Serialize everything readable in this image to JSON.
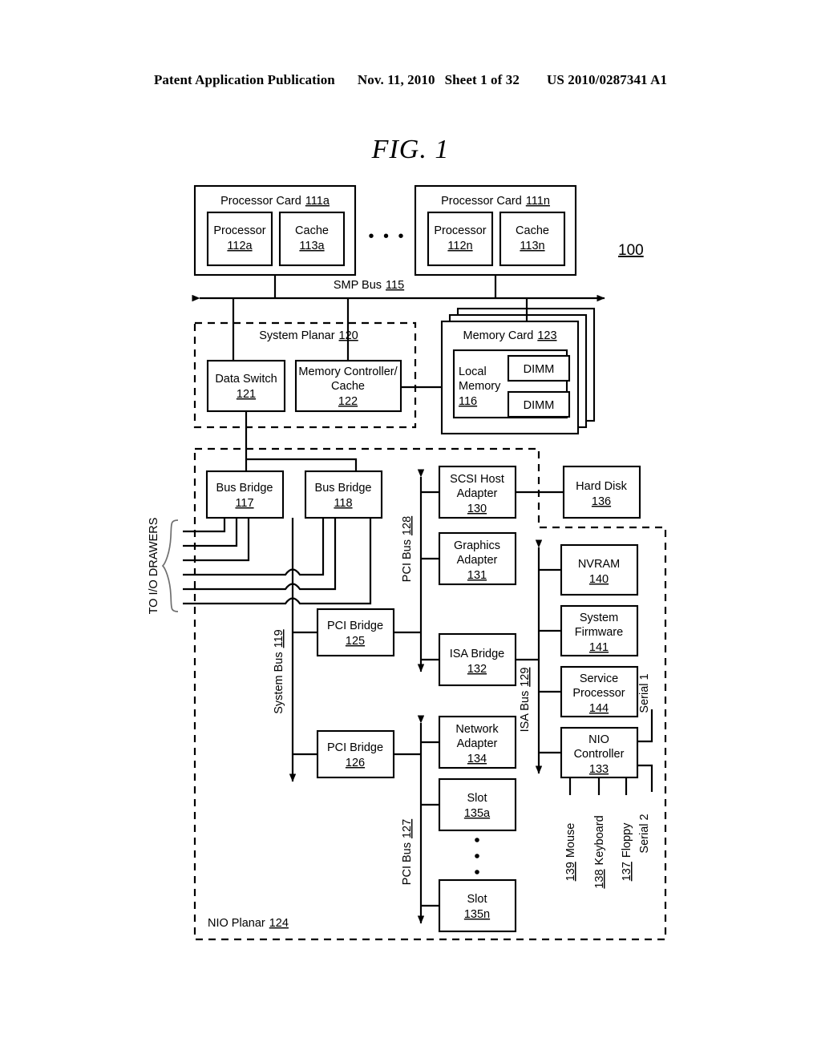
{
  "header": {
    "publication": "Patent Application Publication",
    "date": "Nov. 11, 2010",
    "sheet": "Sheet 1 of 32",
    "patent_number": "US 2010/0287341 A1"
  },
  "figure": {
    "title": "FIG. 1",
    "system_ref": "100"
  },
  "processor_cards": [
    {
      "title": "Processor Card",
      "ref": "111a",
      "processor": {
        "label": "Processor",
        "ref": "112a"
      },
      "cache": {
        "label": "Cache",
        "ref": "113a"
      }
    },
    {
      "title": "Processor Card",
      "ref": "111n",
      "processor": {
        "label": "Processor",
        "ref": "112n"
      },
      "cache": {
        "label": "Cache",
        "ref": "113n"
      }
    }
  ],
  "ellipsis_between_cards": "• • •",
  "buses": {
    "smp": {
      "label": "SMP Bus",
      "ref": "115"
    },
    "system": {
      "label": "System Bus",
      "ref": "119"
    },
    "pci_128": {
      "label": "PCI Bus",
      "ref": "128"
    },
    "pci_127": {
      "label": "PCI Bus",
      "ref": "127"
    },
    "isa_129": {
      "label": "ISA Bus",
      "ref": "129"
    }
  },
  "system_planar": {
    "label": "System Planar",
    "ref": "120"
  },
  "nio_planar": {
    "label": "NIO Planar",
    "ref": "124"
  },
  "io_drawers_label": "TO I/O DRAWERS",
  "memory_card": {
    "title": "Memory Card",
    "ref": "123",
    "local_memory": {
      "line1": "Local",
      "line2": "Memory",
      "ref": "116"
    },
    "dimms": [
      "DIMM",
      "DIMM"
    ]
  },
  "blocks": {
    "data_switch": {
      "line1": "Data Switch",
      "ref": "121"
    },
    "memory_controller": {
      "line1": "Memory Controller/",
      "line2": "Cache",
      "ref": "122"
    },
    "bus_bridge_117": {
      "line1": "Bus Bridge",
      "ref": "117"
    },
    "bus_bridge_118": {
      "line1": "Bus Bridge",
      "ref": "118"
    },
    "pci_bridge_125": {
      "line1": "PCI Bridge",
      "ref": "125"
    },
    "pci_bridge_126": {
      "line1": "PCI Bridge",
      "ref": "126"
    },
    "scsi_host_adapter": {
      "line1": "SCSI Host",
      "line2": "Adapter",
      "ref": "130"
    },
    "graphics_adapter": {
      "line1": "Graphics",
      "line2": "Adapter",
      "ref": "131"
    },
    "isa_bridge": {
      "line1": "ISA Bridge",
      "ref": "132"
    },
    "network_adapter": {
      "line1": "Network",
      "line2": "Adapter",
      "ref": "134"
    },
    "slot_135a": {
      "line1": "Slot",
      "ref": "135a"
    },
    "slot_135n": {
      "line1": "Slot",
      "ref": "135n"
    },
    "hard_disk": {
      "line1": "Hard Disk",
      "ref": "136"
    },
    "nvram": {
      "line1": "NVRAM",
      "ref": "140"
    },
    "system_firmware": {
      "line1": "System",
      "line2": "Firmware",
      "ref": "141"
    },
    "service_processor": {
      "line1": "Service",
      "line2": "Processor",
      "ref": "144"
    },
    "nio_controller": {
      "line1": "NIO",
      "line2": "Controller",
      "ref": "133"
    }
  },
  "slot_ellipsis": "•\n•\n•",
  "ports": {
    "serial_1": "Serial 1",
    "serial_2": "Serial 2",
    "mouse": {
      "ref": "139",
      "label": "Mouse"
    },
    "keyboard": {
      "ref": "138",
      "label": "Keyboard"
    },
    "floppy": {
      "ref": "137",
      "label": "Floppy"
    }
  }
}
